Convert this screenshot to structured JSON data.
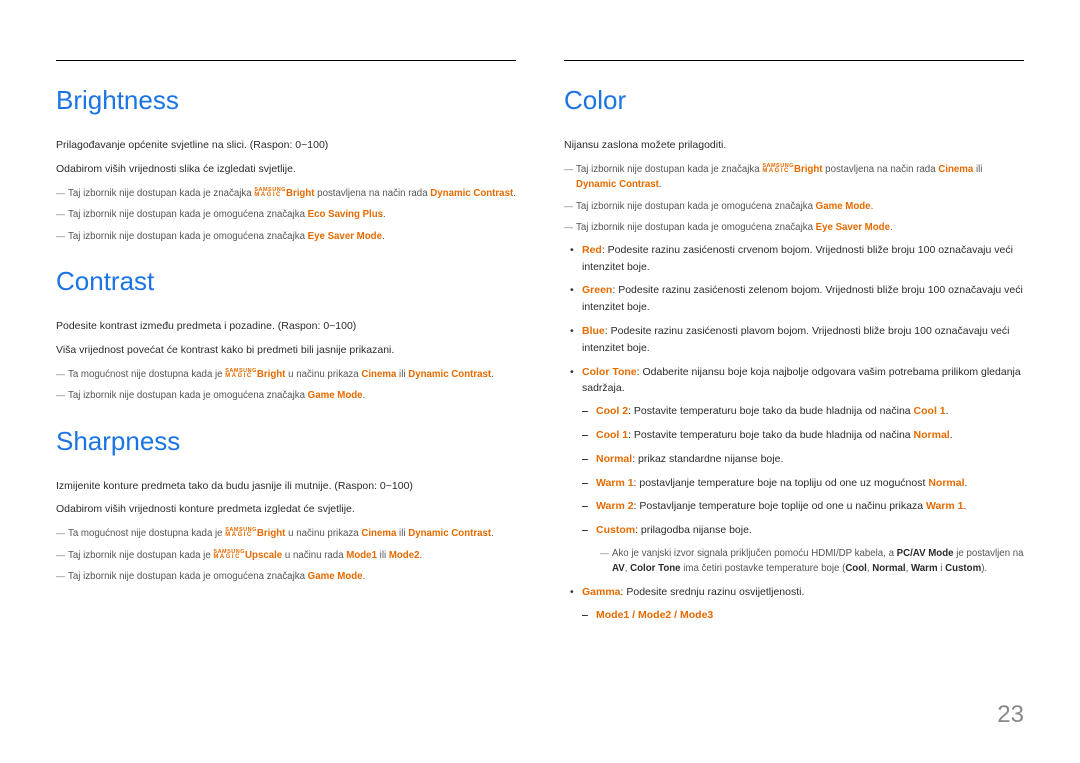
{
  "page_number": "23",
  "magic": {
    "top": "SAMSUNG",
    "bottom": "MAGIC"
  },
  "left": {
    "brightness": {
      "title": "Brightness",
      "p1": "Prilagođavanje općenite svjetline na slici. (Raspon: 0~100)",
      "p2": "Odabirom viših vrijednosti slika će izgledati svjetlije.",
      "n1_a": "Taj izbornik nije dostupan kada je značajka ",
      "n1_b": "Bright",
      "n1_c": " postavljena na način rada ",
      "n1_d": "Dynamic Contrast",
      "n2_a": "Taj izbornik nije dostupan kada je omogućena značajka ",
      "n2_b": "Eco Saving Plus",
      "n3_a": "Taj izbornik nije dostupan kada je omogućena značajka ",
      "n3_b": "Eye Saver Mode"
    },
    "contrast": {
      "title": "Contrast",
      "p1": "Podesite kontrast između predmeta i pozadine. (Raspon: 0~100)",
      "p2": "Viša vrijednost povećat će kontrast kako bi predmeti bili jasnije prikazani.",
      "n1_a": "Ta mogućnost nije dostupna kada je ",
      "n1_b": "Bright",
      "n1_c": " u načinu prikaza ",
      "n1_d": "Cinema",
      "n1_e": " ili ",
      "n1_f": "Dynamic Contrast",
      "n2_a": "Taj izbornik nije dostupan kada je omogućena značajka ",
      "n2_b": "Game Mode"
    },
    "sharpness": {
      "title": "Sharpness",
      "p1": "Izmijenite konture predmeta tako da budu jasnije ili mutnije. (Raspon: 0~100)",
      "p2": "Odabirom viših vrijednosti konture predmeta izgledat će svjetlije.",
      "n1_a": "Ta mogućnost nije dostupna kada je ",
      "n1_b": "Bright",
      "n1_c": " u načinu prikaza ",
      "n1_d": "Cinema",
      "n1_e": " ili ",
      "n1_f": "Dynamic Contrast",
      "n2_a": "Taj izbornik nije dostupan kada je ",
      "n2_b": "Upscale",
      "n2_c": " u načinu rada ",
      "n2_d": "Mode1",
      "n2_e": " ili ",
      "n2_f": "Mode2",
      "n3_a": "Taj izbornik nije dostupan kada je omogućena značajka ",
      "n3_b": "Game Mode"
    }
  },
  "right": {
    "color": {
      "title": "Color",
      "p1": "Nijansu zaslona možete prilagoditi.",
      "n1_a": "Taj izbornik nije dostupan kada je značajka ",
      "n1_b": "Bright",
      "n1_c": " postavljena na način rada ",
      "n1_d": "Cinema",
      "n1_e": " ili ",
      "n1_f": "Dynamic Contrast",
      "n2_a": "Taj izbornik nije dostupan kada je omogućena značajka ",
      "n2_b": "Game Mode",
      "n3_a": "Taj izbornik nije dostupan kada je omogućena značajka ",
      "n3_b": "Eye Saver Mode",
      "red_l": "Red",
      "red_t": ": Podesite razinu zasićenosti crvenom bojom. Vrijednosti bliže broju 100 označavaju veći intenzitet boje.",
      "green_l": "Green",
      "green_t": ": Podesite razinu zasićenosti zelenom bojom. Vrijednosti bliže broju 100 označavaju veći intenzitet boje.",
      "blue_l": "Blue",
      "blue_t": ": Podesite razinu zasićenosti plavom bojom. Vrijednosti bliže broju 100 označavaju veći intenzitet boje.",
      "ctone_l": "Color Tone",
      "ctone_t": ": Odaberite nijansu boje koja najbolje odgovara vašim potrebama prilikom gledanja sadržaja.",
      "cool2_l": "Cool 2",
      "cool2_t": ": Postavite temperaturu boje tako da bude hladnija od načina ",
      "cool2_r": "Cool 1",
      "cool1_l": "Cool 1",
      "cool1_t": ": Postavite temperaturu boje tako da bude hladnija od načina ",
      "cool1_r": "Normal",
      "normal_l": "Normal",
      "normal_t": ": prikaz standardne nijanse boje.",
      "warm1_l": "Warm 1",
      "warm1_t": ": postavljanje temperature boje na topliju od one uz mogućnost ",
      "warm1_r": "Normal",
      "warm2_l": "Warm 2",
      "warm2_t": ": Postavljanje temperature boje toplije od one u načinu prikaza ",
      "warm2_r": "Warm 1",
      "custom_l": "Custom",
      "custom_t": ": prilagodba nijanse boje.",
      "subnote_a": "Ako je vanjski izvor signala priključen pomoću HDMI/DP kabela, a ",
      "subnote_b": "PC/AV Mode",
      "subnote_c": " je postavljen na ",
      "subnote_d": "AV",
      "subnote_e": ", ",
      "subnote_f": "Color Tone",
      "subnote_g": " ima četiri postavke temperature boje (",
      "subnote_h": "Cool",
      "subnote_i": ", ",
      "subnote_j": "Normal",
      "subnote_k": ", ",
      "subnote_l": "Warm",
      "subnote_m": " i ",
      "subnote_n": "Custom",
      "subnote_o": ").",
      "gamma_l": "Gamma",
      "gamma_t": ": Podesite srednju razinu osvijetljenosti.",
      "modes": "Mode1 / Mode2 / Mode3"
    }
  }
}
